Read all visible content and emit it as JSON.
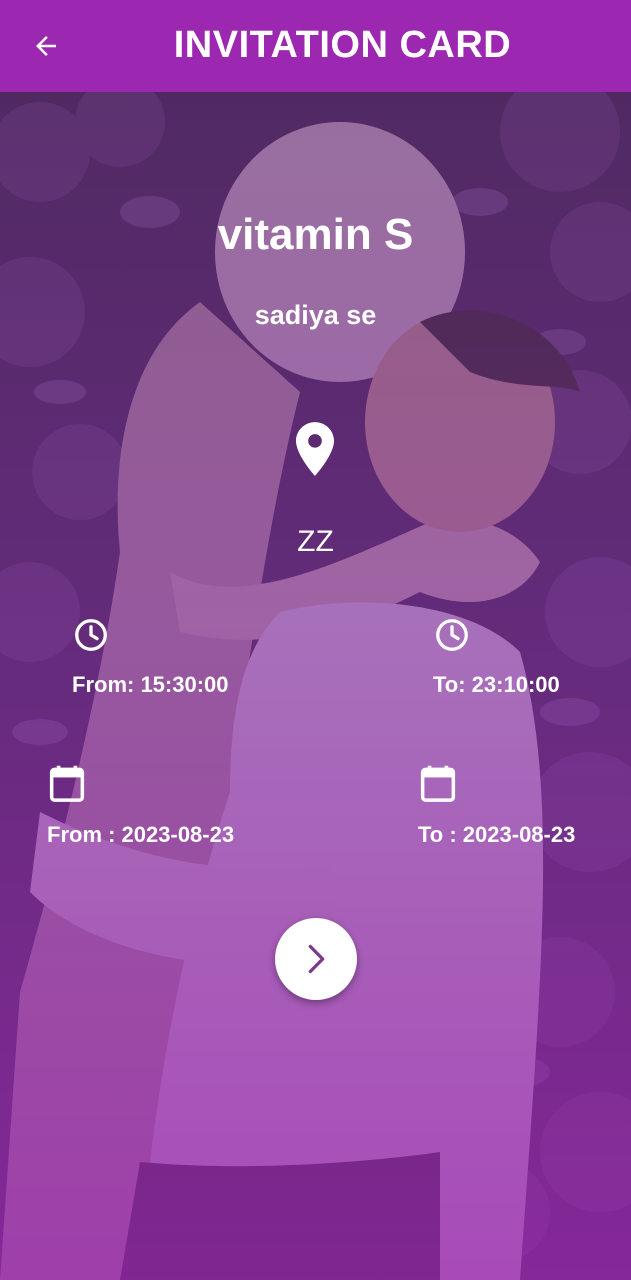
{
  "header": {
    "title": "INVITATION CARD",
    "back_icon": "arrow-left-icon"
  },
  "invitation": {
    "event_name": "vitamin S",
    "host": "sadiya se",
    "location_icon": "location-pin-icon",
    "location": "ZZ",
    "time_from": "From: 15:30:00",
    "time_to": "To: 23:10:00",
    "date_from": "From : 2023-08-23",
    "date_to": "To : 2023-08-23",
    "time_icon": "clock-icon",
    "date_icon": "calendar-icon"
  },
  "actions": {
    "next_icon": "chevron-right-icon"
  },
  "colors": {
    "primary": "#9c27b0",
    "text": "#ffffff",
    "next_chevron": "#7b3b8c"
  }
}
